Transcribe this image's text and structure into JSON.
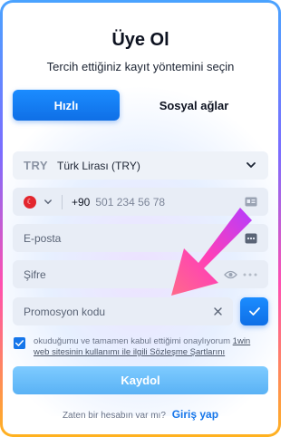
{
  "title": "Üye Ol",
  "subtitle": "Tercih ettiğiniz kayıt yöntemini seçin",
  "tabs": {
    "quick": "Hızlı",
    "social": "Sosyal ağlar"
  },
  "currency": {
    "code": "TRY",
    "name": "Türk Lirası (TRY)"
  },
  "phone": {
    "prefix": "+90",
    "placeholder": "501 234 56 78"
  },
  "email": {
    "placeholder": "E-posta"
  },
  "password": {
    "placeholder": "Şifre"
  },
  "promo": {
    "placeholder": "Promosyon kodu"
  },
  "terms": {
    "text": "okuduğumu ve tamamen kabul ettiğimi onaylıyorum ",
    "link": "1win web sitesinin kullanımı ile ilgili Sözleşme Şartlarını"
  },
  "submit_label": "Kaydol",
  "login": {
    "prompt": "Zaten bir hesabın var mı?",
    "link": "Giriş yap"
  },
  "colors": {
    "accent": "#1676ea",
    "frame_top": "#4aa3ff",
    "frame_bottom": "#ffb21f",
    "arrow": "#ff3fb8"
  },
  "icons": {
    "currency": "chevron-down-icon",
    "phone_contact": "contact-card-icon",
    "email_more": "more-dots-icon",
    "password_show": "eye-icon",
    "promo_clear": "close-icon",
    "promo_apply": "check-icon",
    "terms_checkbox": "checkmark-icon",
    "overlay": "pointer-arrow-icon"
  }
}
